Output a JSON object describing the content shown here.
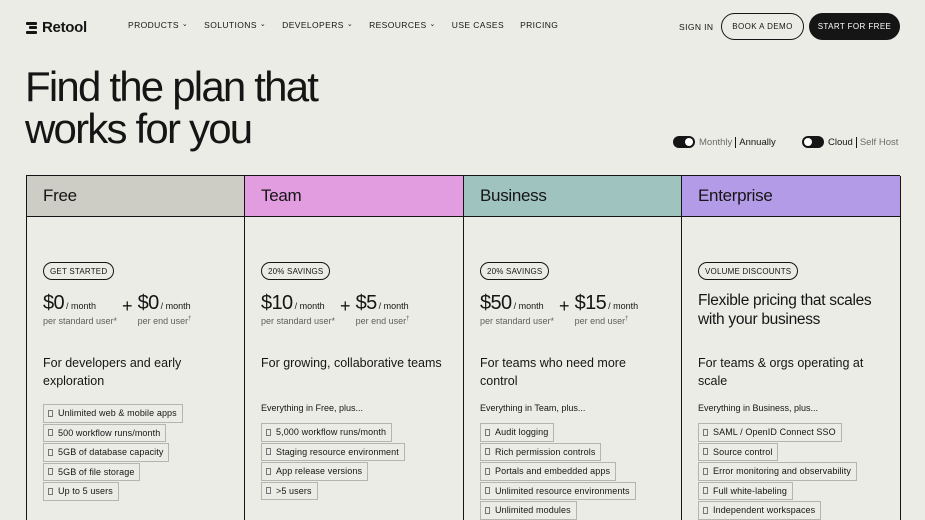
{
  "nav": {
    "logo": "Retool",
    "links": [
      {
        "label": "PRODUCTS",
        "dropdown": true
      },
      {
        "label": "SOLUTIONS",
        "dropdown": true
      },
      {
        "label": "DEVELOPERS",
        "dropdown": true
      },
      {
        "label": "RESOURCES",
        "dropdown": true
      },
      {
        "label": "USE CASES",
        "dropdown": false
      },
      {
        "label": "PRICING",
        "dropdown": false
      }
    ],
    "sign_in": "SIGN IN",
    "book_demo": "BOOK A DEMO",
    "start_free": "START FOR FREE",
    "chevron": "⌄"
  },
  "hero": {
    "line1": "Find the plan that",
    "line2": "works for you"
  },
  "toggles": {
    "billing": {
      "left": "Monthly",
      "right": "Annually",
      "selected": "Annually"
    },
    "hosting": {
      "left": "Cloud",
      "right": "Self Host",
      "selected": "Cloud"
    }
  },
  "plans": [
    {
      "name": "Free",
      "header_color": "#cdcdc5",
      "badge": "GET STARTED",
      "price_standard": "$0",
      "price_standard_period": "/ month",
      "price_standard_sub": "per standard user*",
      "plus": "+",
      "price_end": "$0",
      "price_end_period": "/ month",
      "price_end_sub": "per end user",
      "price_end_mark": "†",
      "description": "For developers and early exploration",
      "features": [
        "Unlimited web & mobile apps",
        "500 workflow runs/month",
        "5GB of database capacity",
        "5GB of file storage",
        "Up to 5 users"
      ]
    },
    {
      "name": "Team",
      "header_color": "#e29de0",
      "badge": "20% SAVINGS",
      "price_standard": "$10",
      "price_standard_period": "/ month",
      "price_standard_sub": "per standard user*",
      "plus": "+",
      "price_end": "$5",
      "price_end_period": "/ month",
      "price_end_sub": "per end user",
      "price_end_mark": "†",
      "description": "For growing, collaborative teams",
      "includes": "Everything in Free, plus...",
      "features": [
        "5,000 workflow runs/month",
        "Staging resource environment",
        "App release versions",
        ">5 users"
      ]
    },
    {
      "name": "Business",
      "header_color": "#9fc3bf",
      "badge": "20% SAVINGS",
      "price_standard": "$50",
      "price_standard_period": "/ month",
      "price_standard_sub": "per standard user*",
      "plus": "+",
      "price_end": "$15",
      "price_end_period": "/ month",
      "price_end_sub": "per end user",
      "price_end_mark": "†",
      "description": "For teams who need more control",
      "includes": "Everything in Team, plus...",
      "features": [
        "Audit logging",
        "Rich permission controls",
        "Portals and embedded apps",
        "Unlimited resource environments",
        "Unlimited modules"
      ]
    },
    {
      "name": "Enterprise",
      "header_color": "#b49be8",
      "badge": "VOLUME DISCOUNTS",
      "headline": "Flexible pricing that scales with your business",
      "description": "For teams & orgs operating at scale",
      "includes": "Everything in Business, plus...",
      "features": [
        "SAML / OpenID Connect SSO",
        "Source control",
        "Error monitoring and observability",
        "Full white-labeling",
        "Independent workspaces"
      ]
    }
  ]
}
